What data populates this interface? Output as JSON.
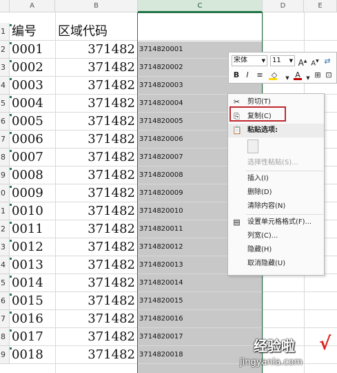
{
  "columns": [
    "A",
    "B",
    "C",
    "D",
    "E"
  ],
  "row_numbers": [
    "1",
    "2",
    "3",
    "4",
    "5",
    "6",
    "7",
    "8",
    "9",
    "0",
    "1",
    "2",
    "3",
    "4",
    "5",
    "6",
    "7",
    "8",
    "9"
  ],
  "header_row": {
    "a": "编号",
    "b": "区域代码",
    "c": ""
  },
  "rows": [
    {
      "a": "0001",
      "b": "371482",
      "c": "3714820001"
    },
    {
      "a": "0002",
      "b": "371482",
      "c": "3714820002"
    },
    {
      "a": "0003",
      "b": "371482",
      "c": "3714820003"
    },
    {
      "a": "0004",
      "b": "371482",
      "c": "3714820004"
    },
    {
      "a": "0005",
      "b": "371482",
      "c": "3714820005"
    },
    {
      "a": "0006",
      "b": "371482",
      "c": "3714820006"
    },
    {
      "a": "0007",
      "b": "371482",
      "c": "3714820007"
    },
    {
      "a": "0008",
      "b": "371482",
      "c": "3714820008"
    },
    {
      "a": "0009",
      "b": "371482",
      "c": "3714820009"
    },
    {
      "a": "0010",
      "b": "371482",
      "c": "3714820010"
    },
    {
      "a": "0011",
      "b": "371482",
      "c": "3714820011"
    },
    {
      "a": "0012",
      "b": "371482",
      "c": "3714820012"
    },
    {
      "a": "0013",
      "b": "371482",
      "c": "3714820013"
    },
    {
      "a": "0014",
      "b": "371482",
      "c": "3714820014"
    },
    {
      "a": "0015",
      "b": "371482",
      "c": "3714820015"
    },
    {
      "a": "0016",
      "b": "371482",
      "c": "3714820016"
    },
    {
      "a": "0017",
      "b": "371482",
      "c": "3714820017"
    },
    {
      "a": "0018",
      "b": "371482",
      "c": "3714820018"
    }
  ],
  "mini_toolbar": {
    "font_name": "宋体",
    "font_size": "11",
    "grow_font": "A",
    "shrink_font": "A",
    "bold": "B",
    "italic": "I",
    "font_color_letter": "A",
    "font_color": "#c00000",
    "fill_color": "#ffd700"
  },
  "context_menu": {
    "cut": "剪切(T)",
    "copy": "复制(C)",
    "paste_options_header": "粘贴选项:",
    "paste_special": "选择性粘贴(S)...",
    "insert": "插入(I)",
    "delete": "删除(D)",
    "clear_contents": "清除内容(N)",
    "format_cells": "设置单元格格式(F)...",
    "column_width": "列宽(C)...",
    "hide": "隐藏(H)",
    "unhide": "取消隐藏(U)"
  },
  "watermark": {
    "title": "经验啦",
    "url": "jingyanla.com",
    "check": "√"
  },
  "colors": {
    "selection_green": "#217346",
    "highlight_red": "#c0272d",
    "selected_fill": "#c8c8c8"
  }
}
